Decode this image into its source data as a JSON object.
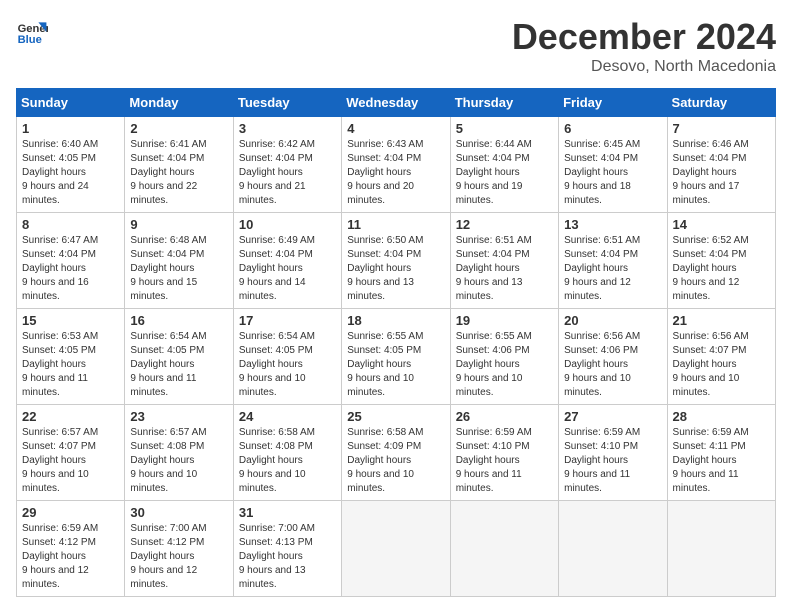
{
  "logo": {
    "line1": "General",
    "line2": "Blue"
  },
  "title": {
    "month_year": "December 2024",
    "location": "Desovo, North Macedonia"
  },
  "days_of_week": [
    "Sunday",
    "Monday",
    "Tuesday",
    "Wednesday",
    "Thursday",
    "Friday",
    "Saturday"
  ],
  "weeks": [
    [
      {
        "day": "1",
        "sunrise": "6:40 AM",
        "sunset": "4:05 PM",
        "daylight": "9 hours and 24 minutes."
      },
      {
        "day": "2",
        "sunrise": "6:41 AM",
        "sunset": "4:04 PM",
        "daylight": "9 hours and 22 minutes."
      },
      {
        "day": "3",
        "sunrise": "6:42 AM",
        "sunset": "4:04 PM",
        "daylight": "9 hours and 21 minutes."
      },
      {
        "day": "4",
        "sunrise": "6:43 AM",
        "sunset": "4:04 PM",
        "daylight": "9 hours and 20 minutes."
      },
      {
        "day": "5",
        "sunrise": "6:44 AM",
        "sunset": "4:04 PM",
        "daylight": "9 hours and 19 minutes."
      },
      {
        "day": "6",
        "sunrise": "6:45 AM",
        "sunset": "4:04 PM",
        "daylight": "9 hours and 18 minutes."
      },
      {
        "day": "7",
        "sunrise": "6:46 AM",
        "sunset": "4:04 PM",
        "daylight": "9 hours and 17 minutes."
      }
    ],
    [
      {
        "day": "8",
        "sunrise": "6:47 AM",
        "sunset": "4:04 PM",
        "daylight": "9 hours and 16 minutes."
      },
      {
        "day": "9",
        "sunrise": "6:48 AM",
        "sunset": "4:04 PM",
        "daylight": "9 hours and 15 minutes."
      },
      {
        "day": "10",
        "sunrise": "6:49 AM",
        "sunset": "4:04 PM",
        "daylight": "9 hours and 14 minutes."
      },
      {
        "day": "11",
        "sunrise": "6:50 AM",
        "sunset": "4:04 PM",
        "daylight": "9 hours and 13 minutes."
      },
      {
        "day": "12",
        "sunrise": "6:51 AM",
        "sunset": "4:04 PM",
        "daylight": "9 hours and 13 minutes."
      },
      {
        "day": "13",
        "sunrise": "6:51 AM",
        "sunset": "4:04 PM",
        "daylight": "9 hours and 12 minutes."
      },
      {
        "day": "14",
        "sunrise": "6:52 AM",
        "sunset": "4:04 PM",
        "daylight": "9 hours and 12 minutes."
      }
    ],
    [
      {
        "day": "15",
        "sunrise": "6:53 AM",
        "sunset": "4:05 PM",
        "daylight": "9 hours and 11 minutes."
      },
      {
        "day": "16",
        "sunrise": "6:54 AM",
        "sunset": "4:05 PM",
        "daylight": "9 hours and 11 minutes."
      },
      {
        "day": "17",
        "sunrise": "6:54 AM",
        "sunset": "4:05 PM",
        "daylight": "9 hours and 10 minutes."
      },
      {
        "day": "18",
        "sunrise": "6:55 AM",
        "sunset": "4:05 PM",
        "daylight": "9 hours and 10 minutes."
      },
      {
        "day": "19",
        "sunrise": "6:55 AM",
        "sunset": "4:06 PM",
        "daylight": "9 hours and 10 minutes."
      },
      {
        "day": "20",
        "sunrise": "6:56 AM",
        "sunset": "4:06 PM",
        "daylight": "9 hours and 10 minutes."
      },
      {
        "day": "21",
        "sunrise": "6:56 AM",
        "sunset": "4:07 PM",
        "daylight": "9 hours and 10 minutes."
      }
    ],
    [
      {
        "day": "22",
        "sunrise": "6:57 AM",
        "sunset": "4:07 PM",
        "daylight": "9 hours and 10 minutes."
      },
      {
        "day": "23",
        "sunrise": "6:57 AM",
        "sunset": "4:08 PM",
        "daylight": "9 hours and 10 minutes."
      },
      {
        "day": "24",
        "sunrise": "6:58 AM",
        "sunset": "4:08 PM",
        "daylight": "9 hours and 10 minutes."
      },
      {
        "day": "25",
        "sunrise": "6:58 AM",
        "sunset": "4:09 PM",
        "daylight": "9 hours and 10 minutes."
      },
      {
        "day": "26",
        "sunrise": "6:59 AM",
        "sunset": "4:10 PM",
        "daylight": "9 hours and 11 minutes."
      },
      {
        "day": "27",
        "sunrise": "6:59 AM",
        "sunset": "4:10 PM",
        "daylight": "9 hours and 11 minutes."
      },
      {
        "day": "28",
        "sunrise": "6:59 AM",
        "sunset": "4:11 PM",
        "daylight": "9 hours and 11 minutes."
      }
    ],
    [
      {
        "day": "29",
        "sunrise": "6:59 AM",
        "sunset": "4:12 PM",
        "daylight": "9 hours and 12 minutes."
      },
      {
        "day": "30",
        "sunrise": "7:00 AM",
        "sunset": "4:12 PM",
        "daylight": "9 hours and 12 minutes."
      },
      {
        "day": "31",
        "sunrise": "7:00 AM",
        "sunset": "4:13 PM",
        "daylight": "9 hours and 13 minutes."
      },
      null,
      null,
      null,
      null
    ]
  ]
}
